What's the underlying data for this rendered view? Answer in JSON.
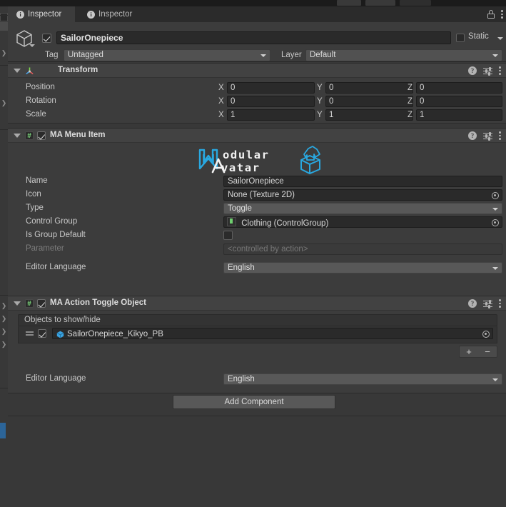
{
  "window": {
    "tabs": [
      {
        "label": "Inspector",
        "icon": "info-icon",
        "active": true
      },
      {
        "label": "Inspector",
        "icon": "info-icon",
        "active": false
      }
    ],
    "lock_icon": "lock-icon",
    "menu_icon": "kebab-menu-icon"
  },
  "game_object": {
    "enabled": true,
    "name": "SailorOnepiece",
    "static_label": "Static",
    "static_checked": false,
    "tag_label": "Tag",
    "tag_value": "Untagged",
    "layer_label": "Layer",
    "layer_value": "Default",
    "icon": "gameobject-cube-icon"
  },
  "transform": {
    "title": "Transform",
    "icon": "transform-axis-icon",
    "rows": [
      {
        "label": "Position",
        "x": "0",
        "y": "0",
        "z": "0"
      },
      {
        "label": "Rotation",
        "x": "0",
        "y": "0",
        "z": "0"
      },
      {
        "label": "Scale",
        "x": "1",
        "y": "1",
        "z": "1"
      }
    ],
    "axis_labels": {
      "x": "X",
      "y": "Y",
      "z": "Z"
    }
  },
  "menu_item": {
    "title": "MA Menu Item",
    "enabled": true,
    "logo": {
      "word1": "odular",
      "word2": "vatar",
      "alt": "Modular Avatar"
    },
    "fields": {
      "name_label": "Name",
      "name_value": "SailorOnepiece",
      "icon_label": "Icon",
      "icon_value": "None (Texture 2D)",
      "type_label": "Type",
      "type_value": "Toggle",
      "control_group_label": "Control Group",
      "control_group_value": "Clothing (ControlGroup)",
      "is_group_default_label": "Is Group Default",
      "is_group_default_checked": false,
      "parameter_label": "Parameter",
      "parameter_value": "<controlled by action>",
      "editor_language_label": "Editor Language",
      "editor_language_value": "English"
    }
  },
  "action_toggle": {
    "title": "MA Action Toggle Object",
    "enabled": true,
    "list_header": "Objects to show/hide",
    "items": [
      {
        "name": "SailorOnepiece_Kikyo_PB",
        "checked": true,
        "icon": "prefab-cube-icon"
      }
    ],
    "add_button": "+",
    "remove_button": "−",
    "editor_language_label": "Editor Language",
    "editor_language_value": "English"
  },
  "footer": {
    "add_component_label": "Add Component"
  },
  "colors": {
    "panel_bg": "#383838",
    "component_bg": "#3c3c3c",
    "header_bg": "#424242",
    "field_bg": "#2a2a2a",
    "popup_bg": "#585858",
    "accent_blue": "#2c6599",
    "logo_blue": "#29a8e0",
    "script_green": "#7ddc7d",
    "text": "#c8c8c8",
    "text_dim": "#7d7d7d"
  }
}
